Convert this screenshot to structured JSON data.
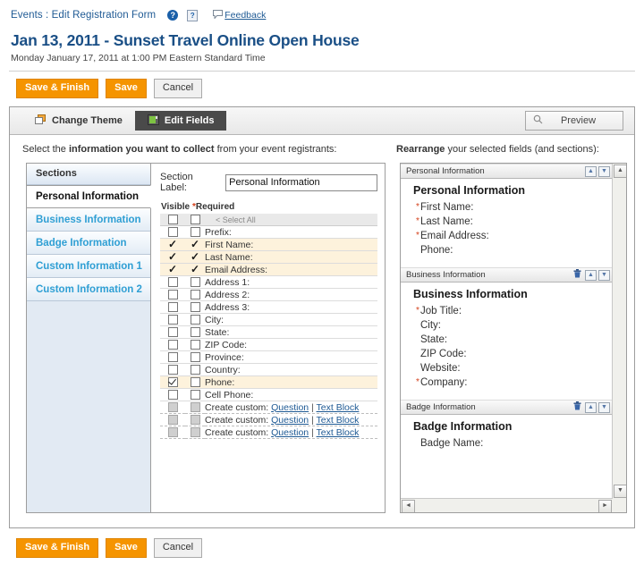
{
  "breadcrumb": {
    "text": "Events : Edit Registration Form",
    "help_icon": "help-circle-icon",
    "help_square": "?",
    "feedback_label": "Feedback"
  },
  "header": {
    "title": "Jan 13, 2011 - Sunset Travel Online Open House",
    "subtitle": "Monday January 17, 2011 at 1:00 PM Eastern Standard Time"
  },
  "actions": {
    "save_finish": "Save & Finish",
    "save": "Save",
    "cancel": "Cancel"
  },
  "tabs": [
    {
      "label": "Change Theme",
      "icon": "theme-icon",
      "active": false
    },
    {
      "label": "Edit Fields",
      "icon": "fields-icon",
      "active": true
    }
  ],
  "preview": {
    "label": "Preview",
    "icon": "search-icon"
  },
  "instructions": {
    "left_prefix": "Select the ",
    "left_bold": "information you want to collect",
    "left_suffix": " from your event registrants:",
    "right_bold": "Rearrange",
    "right_suffix": " your selected fields (and sections):"
  },
  "sections_panel": {
    "header": "Sections",
    "items": [
      {
        "label": "Personal Information",
        "selected": true
      },
      {
        "label": "Business Information",
        "selected": false
      },
      {
        "label": "Badge Information",
        "selected": false
      },
      {
        "label": "Custom Information 1",
        "selected": false
      },
      {
        "label": "Custom Information 2",
        "selected": false
      }
    ]
  },
  "fields_panel": {
    "section_label_caption": "Section Label:",
    "section_label_value": "Personal Information",
    "section_label_placeholder": "Section Label",
    "col_visible": "Visible",
    "col_required_star": "*",
    "col_required": "Required",
    "select_all_label": "< Select All",
    "rows": [
      {
        "label": "Prefix:",
        "visible": "unchecked",
        "required": "unchecked",
        "highlight": false,
        "custom": false
      },
      {
        "label": "First Name:",
        "visible": "tick",
        "required": "tick",
        "highlight": true,
        "custom": false
      },
      {
        "label": "Last Name:",
        "visible": "tick",
        "required": "tick",
        "highlight": true,
        "custom": false
      },
      {
        "label": "Email Address:",
        "visible": "tick",
        "required": "tick",
        "highlight": true,
        "custom": false
      },
      {
        "label": "Address 1:",
        "visible": "unchecked",
        "required": "unchecked",
        "highlight": false,
        "custom": false
      },
      {
        "label": "Address 2:",
        "visible": "unchecked",
        "required": "unchecked",
        "highlight": false,
        "custom": false
      },
      {
        "label": "Address 3:",
        "visible": "unchecked",
        "required": "unchecked",
        "highlight": false,
        "custom": false
      },
      {
        "label": "City:",
        "visible": "unchecked",
        "required": "unchecked",
        "highlight": false,
        "custom": false
      },
      {
        "label": "State:",
        "visible": "unchecked",
        "required": "unchecked",
        "highlight": false,
        "custom": false
      },
      {
        "label": "ZIP Code:",
        "visible": "unchecked",
        "required": "unchecked",
        "highlight": false,
        "custom": false
      },
      {
        "label": "Province:",
        "visible": "unchecked",
        "required": "unchecked",
        "highlight": false,
        "custom": false
      },
      {
        "label": "Country:",
        "visible": "unchecked",
        "required": "unchecked",
        "highlight": false,
        "custom": false
      },
      {
        "label": "Phone:",
        "visible": "checked",
        "required": "unchecked",
        "highlight": true,
        "custom": false
      },
      {
        "label": "Cell Phone:",
        "visible": "unchecked",
        "required": "unchecked",
        "highlight": false,
        "custom": false
      },
      {
        "label": "Create custom:",
        "visible": "disabled",
        "required": "disabled",
        "highlight": false,
        "custom": true
      },
      {
        "label": "Create custom:",
        "visible": "disabled",
        "required": "disabled",
        "highlight": false,
        "custom": true
      },
      {
        "label": "Create custom:",
        "visible": "disabled",
        "required": "disabled",
        "highlight": false,
        "custom": true
      }
    ],
    "custom_question_link": "Question",
    "custom_separator": "|",
    "custom_textblock_link": "Text Block"
  },
  "rearrange_panel": {
    "sections": [
      {
        "bar_title": "Personal Information",
        "has_delete": false,
        "title": "Personal Information",
        "fields": [
          {
            "label": "First Name:",
            "required": true
          },
          {
            "label": "Last Name:",
            "required": true
          },
          {
            "label": "Email Address:",
            "required": true
          },
          {
            "label": "Phone:",
            "required": false
          }
        ]
      },
      {
        "bar_title": "Business Information",
        "has_delete": true,
        "title": "Business Information",
        "fields": [
          {
            "label": "Job Title:",
            "required": true
          },
          {
            "label": "City:",
            "required": false
          },
          {
            "label": "State:",
            "required": false
          },
          {
            "label": "ZIP Code:",
            "required": false
          },
          {
            "label": "Website:",
            "required": false
          },
          {
            "label": "Company:",
            "required": true
          }
        ]
      },
      {
        "bar_title": "Badge Information",
        "has_delete": true,
        "title": "Badge Information",
        "fields": [
          {
            "label": "Badge Name:",
            "required": false
          }
        ]
      }
    ],
    "move_up_glyph": "▲",
    "move_down_glyph": "▼",
    "scroll_up_glyph": "▲",
    "scroll_down_glyph": "▼",
    "scroll_left_glyph": "◄",
    "scroll_right_glyph": "►"
  },
  "colors": {
    "brand_blue": "#1a4f86",
    "link_blue": "#1f5a94",
    "section_link": "#2f9fd4",
    "orange_button": "#f59400",
    "required_star": "#d43f1a",
    "row_highlight": "#fdf2dc",
    "active_tab": "#4a4a4a"
  }
}
